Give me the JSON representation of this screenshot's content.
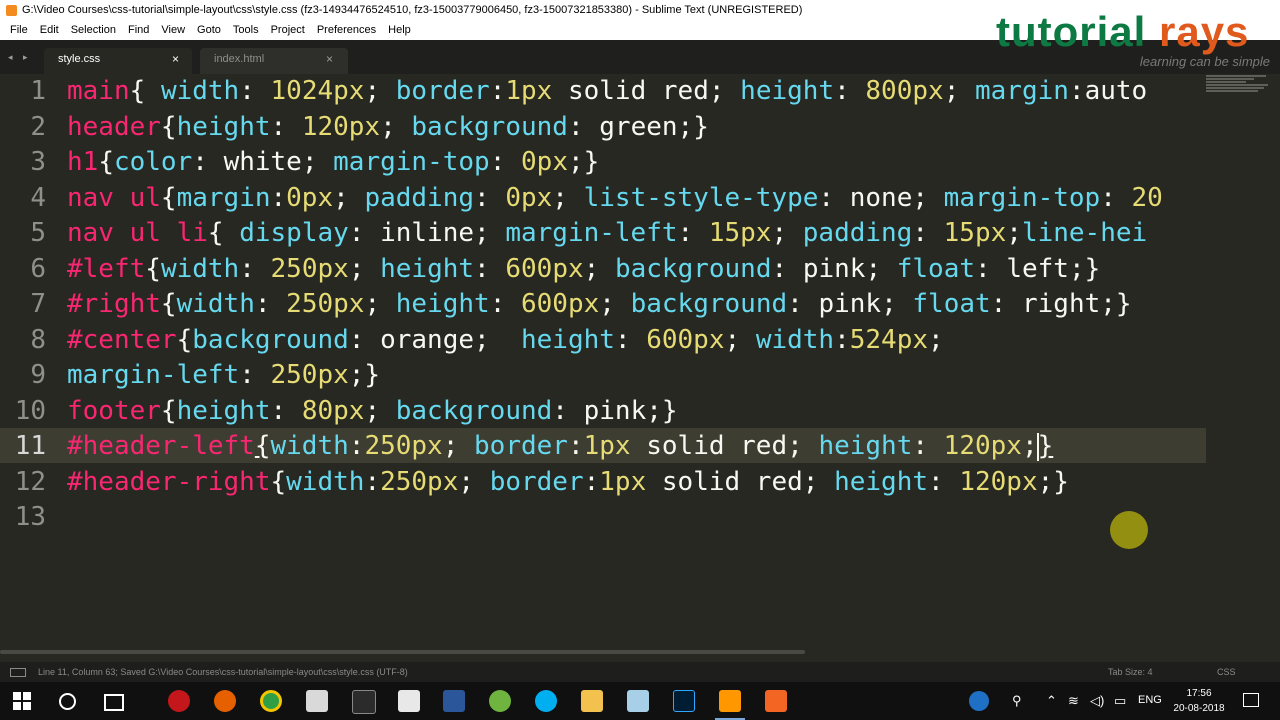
{
  "window": {
    "title": "G:\\Video Courses\\css-tutorial\\simple-layout\\css\\style.css (fz3-14934476524510, fz3-15003779006450, fz3-15007321853380) - Sublime Text (UNREGISTERED)"
  },
  "menu": [
    "File",
    "Edit",
    "Selection",
    "Find",
    "View",
    "Goto",
    "Tools",
    "Project",
    "Preferences",
    "Help"
  ],
  "logo": {
    "brand_left": "tutorial",
    "brand_right": "rays",
    "tagline": "learning can be simple"
  },
  "tabs": {
    "nav": "◂ ▸",
    "active": {
      "label": "style.css",
      "close": "×"
    },
    "inactive": {
      "label": "index.html",
      "close": "×"
    }
  },
  "editor": {
    "line_numbers": [
      "1",
      "2",
      "3",
      "4",
      "5",
      "6",
      "7",
      "8",
      "9",
      "10",
      "11",
      "12",
      "13"
    ],
    "current_line": 11
  },
  "statusbar": {
    "text": "Line 11, Column 63; Saved G:\\Video Courses\\css-tutorial\\simple-layout\\css\\style.css (UTF-8)",
    "tab_size": "Tab Size: 4",
    "syntax": "CSS"
  },
  "taskbar": {
    "tray_lang": "ENG",
    "time": "17:56",
    "date": "20-08-2018"
  },
  "colors": {
    "editor_bg": "#272822",
    "selector": "#f92672",
    "property": "#66d9ef",
    "number": "#e6db74",
    "text": "#f8f8f2"
  }
}
